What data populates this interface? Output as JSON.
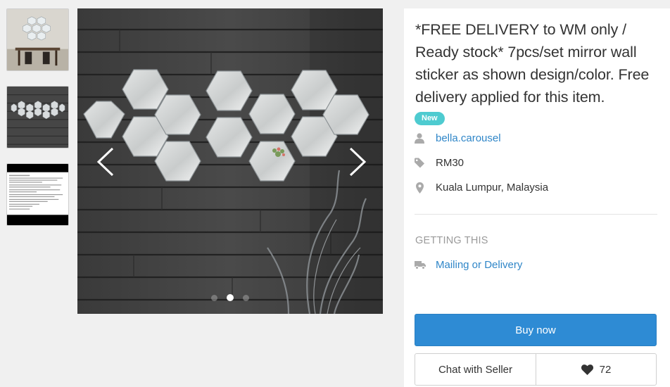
{
  "listing": {
    "title": "*FREE DELIVERY to WM only / Ready stock* 7pcs/set mirror wall sticker as shown design/color. Free delivery applied for this item.",
    "condition_badge": "New",
    "seller": "bella.carousel",
    "price": "RM30",
    "location": "Kuala Lumpur, Malaysia"
  },
  "delivery": {
    "section_label": "GETTING THIS",
    "method": "Mailing or Delivery"
  },
  "actions": {
    "buy_label": "Buy now",
    "chat_label": "Chat with Seller",
    "like_count": "72"
  },
  "gallery": {
    "photo_count": 3,
    "active_index": 1
  },
  "icons": {
    "seller": "user-icon",
    "price": "tag-icon",
    "location": "map-pin-icon",
    "delivery": "truck-icon",
    "like": "heart-icon",
    "prev": "chevron-left-icon",
    "next": "chevron-right-icon"
  },
  "colors": {
    "accent": "#2e8bd4",
    "link": "#2f86c8",
    "badge": "#4ecbd0"
  }
}
